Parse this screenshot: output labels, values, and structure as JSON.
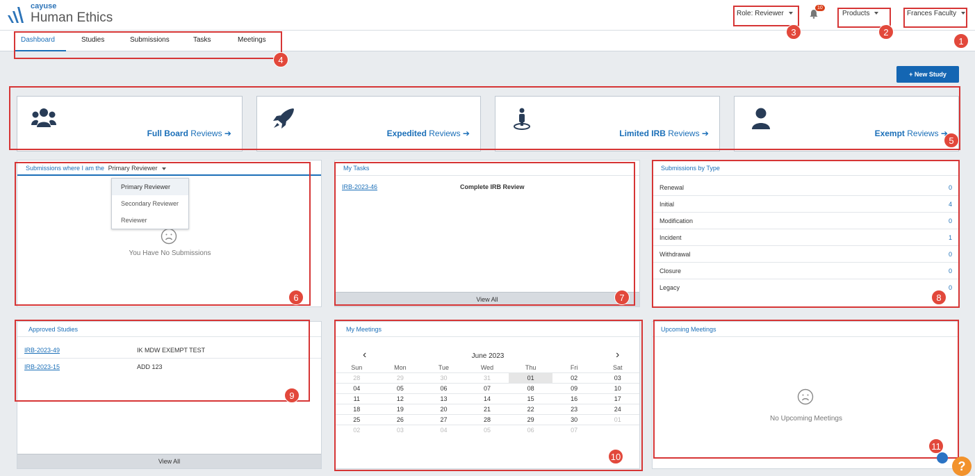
{
  "header": {
    "brand": "cayuse",
    "product": "Human Ethics",
    "role_label": "Role:",
    "role_value": "Reviewer",
    "notification_count": "10",
    "products_label": "Products",
    "user_name": "Frances Faculty"
  },
  "nav": {
    "tabs": [
      {
        "label": "Dashboard"
      },
      {
        "label": "Studies"
      },
      {
        "label": "Submissions"
      },
      {
        "label": "Tasks"
      },
      {
        "label": "Meetings"
      }
    ]
  },
  "actions": {
    "new_study": "+ New Study"
  },
  "review_cards": [
    {
      "strong": "Full Board",
      "rest": " Reviews ➔",
      "icon": "users-icon"
    },
    {
      "strong": "Expedited",
      "rest": " Reviews ➔",
      "icon": "rocket-icon"
    },
    {
      "strong": "Limited IRB",
      "rest": " Reviews ➔",
      "icon": "person-pin-icon"
    },
    {
      "strong": "Exempt",
      "rest": " Reviews ➔",
      "icon": "user-icon"
    }
  ],
  "submissions_panel": {
    "title_prefix": "Submissions where I am the",
    "selected": "Primary Reviewer",
    "options": [
      "Primary Reviewer",
      "Secondary Reviewer",
      "Reviewer"
    ],
    "empty_text": "You Have No Submissions"
  },
  "my_tasks": {
    "title": "My Tasks",
    "rows": [
      {
        "id": "IRB-2023-46",
        "task": "Complete IRB Review"
      }
    ],
    "view_all": "View All"
  },
  "submissions_by_type": {
    "title": "Submissions by Type",
    "rows": [
      {
        "type": "Renewal",
        "count": "0"
      },
      {
        "type": "Initial",
        "count": "4"
      },
      {
        "type": "Modification",
        "count": "0"
      },
      {
        "type": "Incident",
        "count": "1"
      },
      {
        "type": "Withdrawal",
        "count": "0"
      },
      {
        "type": "Closure",
        "count": "0"
      },
      {
        "type": "Legacy",
        "count": "0"
      }
    ]
  },
  "approved_studies": {
    "title": "Approved Studies",
    "rows": [
      {
        "id": "IRB-2023-49",
        "name": "IK MDW EXEMPT TEST"
      },
      {
        "id": "IRB-2023-15",
        "name": "ADD 123"
      }
    ],
    "view_all": "View All"
  },
  "my_meetings": {
    "title": "My Meetings",
    "month": "June 2023",
    "prev": "‹",
    "next": "›",
    "weekdays": [
      "Sun",
      "Mon",
      "Tue",
      "Wed",
      "Thu",
      "Fri",
      "Sat"
    ],
    "weeks": [
      [
        "28",
        "29",
        "30",
        "31",
        "01",
        "02",
        "03"
      ],
      [
        "04",
        "05",
        "06",
        "07",
        "08",
        "09",
        "10"
      ],
      [
        "11",
        "12",
        "13",
        "14",
        "15",
        "16",
        "17"
      ],
      [
        "18",
        "19",
        "20",
        "21",
        "22",
        "23",
        "24"
      ],
      [
        "25",
        "26",
        "27",
        "28",
        "29",
        "30",
        "01"
      ],
      [
        "02",
        "03",
        "04",
        "05",
        "06",
        "07",
        ""
      ]
    ]
  },
  "upcoming_meetings": {
    "title": "Upcoming Meetings",
    "empty_text": "No Upcoming Meetings"
  },
  "callout_numbers": [
    "1",
    "2",
    "3",
    "4",
    "5",
    "6",
    "7",
    "8",
    "9",
    "10",
    "11"
  ],
  "help_label": "?",
  "colors": {
    "accent": "#1b6fb8",
    "callout": "#d63535",
    "badge": "#e2483b",
    "help": "#f2922c"
  }
}
